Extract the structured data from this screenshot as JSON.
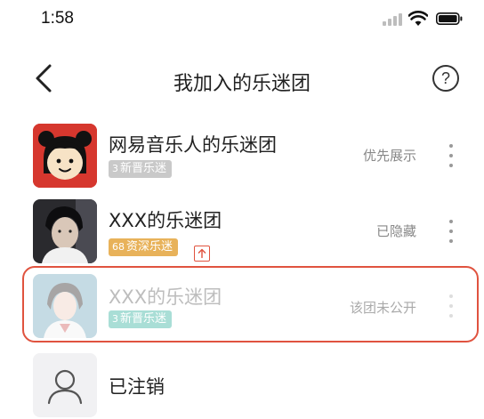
{
  "status_bar": {
    "time": "1:58"
  },
  "nav": {
    "title": "我加入的乐迷团",
    "help_label": "?"
  },
  "rows": [
    {
      "name": "网易音乐人的乐迷团",
      "tag": "新晋乐迷",
      "tag_level": "3",
      "status": "优先展示"
    },
    {
      "name": "XXX的乐迷团",
      "tag": "资深乐迷",
      "tag_level": "68",
      "status": "已隐藏"
    },
    {
      "name": "XXX的乐迷团",
      "tag": "新晋乐迷",
      "tag_level": "3",
      "status": "该团未公开"
    },
    {
      "name": "已注销"
    }
  ],
  "colors": {
    "tag_new": "#c9c9c9",
    "tag_senior": "#e8b25a",
    "tag_new_faded": "#a9ded6",
    "highlight": "#e0533f"
  }
}
